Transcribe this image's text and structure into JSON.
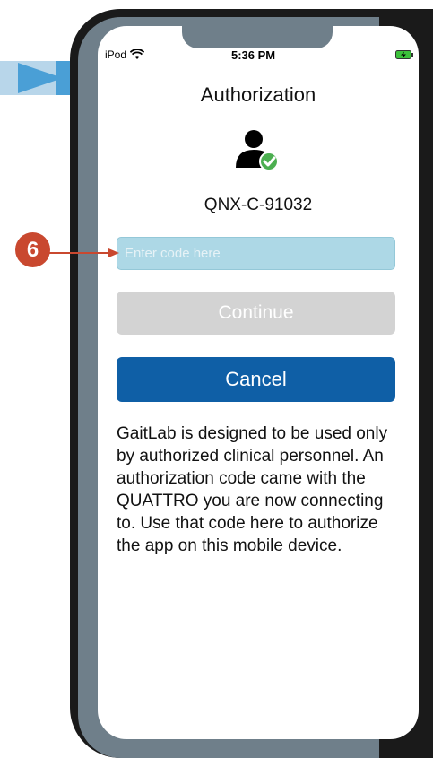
{
  "status_bar": {
    "carrier": "iPod",
    "time": "5:36 PM"
  },
  "icons": {
    "wifi": "wifi-icon",
    "battery": "battery-charging-icon",
    "user": "user-verified-icon"
  },
  "screen": {
    "title": "Authorization",
    "device_id": "QNX-C-91032",
    "code_placeholder": "Enter code here",
    "code_value": "",
    "continue_label": "Continue",
    "cancel_label": "Cancel",
    "info_text": "GaitLab is designed to be used only by authorized clinical personnel. An authorization code came with the QUATTRO you are now connecting to. Use that code here to authorize the app on this mobile device."
  },
  "callout": {
    "number": "6"
  },
  "colors": {
    "accent": "#0f5fa6",
    "input_bg": "#add8e6",
    "disabled": "#d3d3d3",
    "callout": "#c9482f",
    "check": "#4caf50"
  }
}
